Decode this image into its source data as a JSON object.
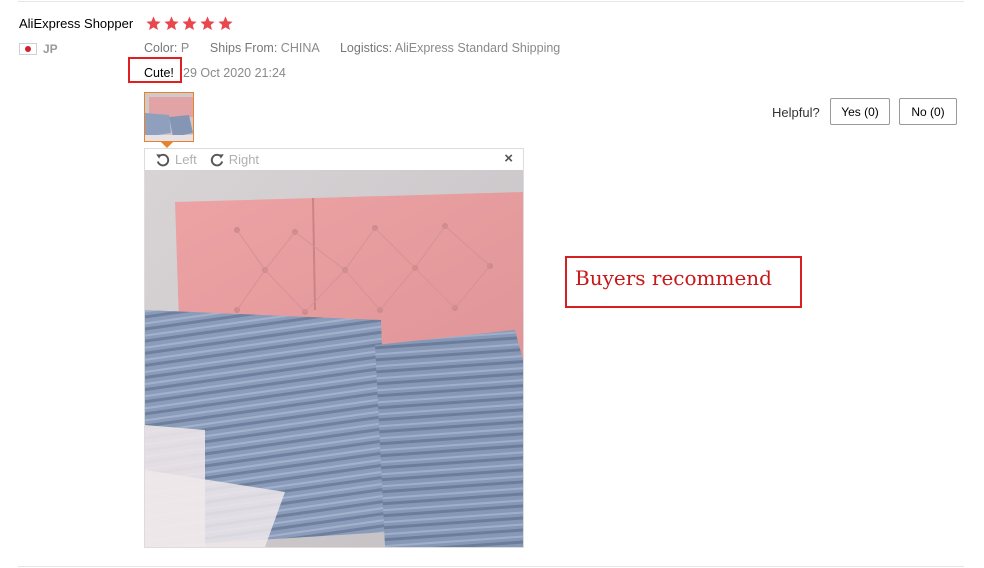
{
  "review": {
    "reviewer_name": "AliExpress Shopper",
    "rating": 5,
    "country_code": "JP",
    "color_label": "Color:",
    "color_value": "P",
    "ships_label": "Ships From:",
    "ships_value": "CHINA",
    "logistics_label": "Logistics:",
    "logistics_value": "AliExpress Standard Shipping",
    "comment": "Cute!",
    "date": "29 Oct 2020 21:24",
    "helpful_label": "Helpful?",
    "yes_label": "Yes (0)",
    "no_label": "No (0)"
  },
  "viewer": {
    "rotate_left_label": "Left",
    "rotate_right_label": "Right",
    "close_icon": "×"
  },
  "annotation": {
    "text": "Buyers recommend"
  },
  "colors": {
    "star": "#e8484d",
    "annotation_red": "#d42020",
    "thumb_border": "#e8822b"
  }
}
